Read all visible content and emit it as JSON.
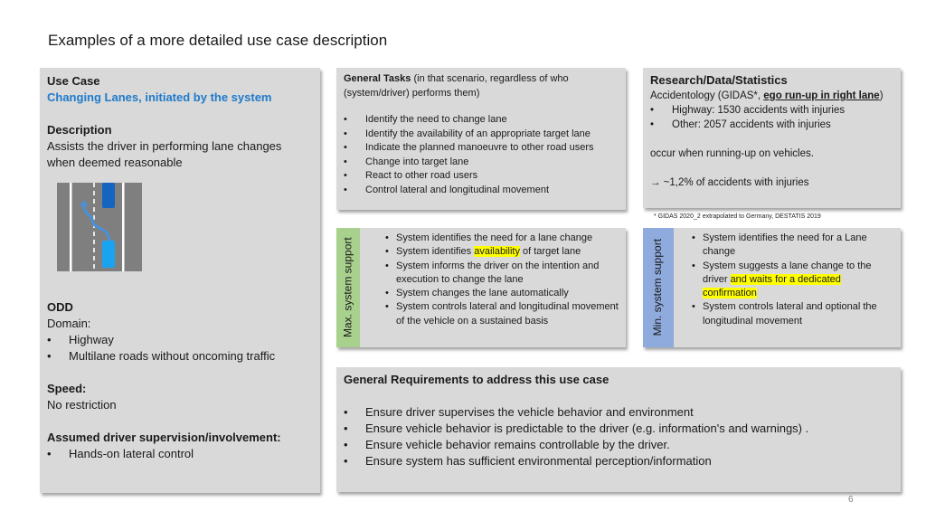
{
  "title": "Examples of a more detailed use case description",
  "use_case": {
    "heading": "Use Case",
    "name": "Changing Lanes, initiated by the system",
    "description_heading": "Description",
    "description": "Assists the driver in performing lane changes when deemed reasonable",
    "illustration": "lane-change-icon",
    "odd_heading": "ODD",
    "domain_label": "Domain:",
    "domain_items": [
      "Highway",
      "Multilane roads without oncoming traffic"
    ],
    "speed_heading": "Speed:",
    "speed_value": "No restriction",
    "supervision_heading": "Assumed driver supervision/involvement:",
    "supervision_items": [
      "Hands-on lateral control"
    ]
  },
  "general_tasks": {
    "heading": "General Tasks",
    "subheading": " (in that scenario, regardless of who (system/driver) performs them)",
    "items": [
      "Identify the need to change lane",
      "Identify the availability of an appropriate target lane",
      "Indicate the planned manoeuvre to other road users",
      "Change into target lane",
      "React to other road users",
      "Control lateral and longitudinal movement"
    ]
  },
  "research": {
    "heading": "Research/Data/Statistics",
    "accidentology_prefix": "Accidentology (GIDAS*, ",
    "accidentology_emph": "ego run-up in right lane",
    "accidentology_suffix": ")",
    "items": [
      "Highway: 1530 accidents with injuries",
      "Other: 2057 accidents with injuries"
    ],
    "occur_text": "occur when running-up on vehicles.",
    "arrow": "→",
    "share_text": " ~1,2% of accidents with injuries",
    "footnote": "* GIDAS 2020_2 extrapolated to Germany, DESTATIS 2019"
  },
  "max_support": {
    "label": "Max. system support",
    "color": "#a9d18e",
    "items": [
      {
        "pre": "System identifies the need for a lane change",
        "hl": "",
        "post": ""
      },
      {
        "pre": "System identifies ",
        "hl": "availability",
        "post": " of target lane"
      },
      {
        "pre": "System informs the driver on the intention and execution to change the lane",
        "hl": "",
        "post": ""
      },
      {
        "pre": "System changes the lane automatically",
        "hl": "",
        "post": ""
      },
      {
        "pre": "System controls lateral and longitudinal movement of the vehicle on a sustained basis",
        "hl": "",
        "post": ""
      }
    ]
  },
  "min_support": {
    "label": "Min. system support",
    "color": "#8faadc",
    "items": [
      {
        "pre": "System identifies the need for a Lane change",
        "hl": "",
        "post": ""
      },
      {
        "pre": "System suggests a lane change to the driver ",
        "hl": "and waits for a dedicated confirmation",
        "post": ""
      },
      {
        "pre": "System controls lateral and optional the longitudinal movement",
        "hl": "",
        "post": ""
      }
    ]
  },
  "requirements": {
    "heading": "General Requirements to address this use case",
    "items": [
      "Ensure driver supervises the vehicle behavior and environment",
      "Ensure vehicle behavior is predictable to the driver (e.g. information's and warnings) .",
      "Ensure vehicle behavior remains controllable by the driver.",
      "Ensure system has sufficient environmental perception/information"
    ]
  },
  "bullet": "•",
  "page_number": "6"
}
